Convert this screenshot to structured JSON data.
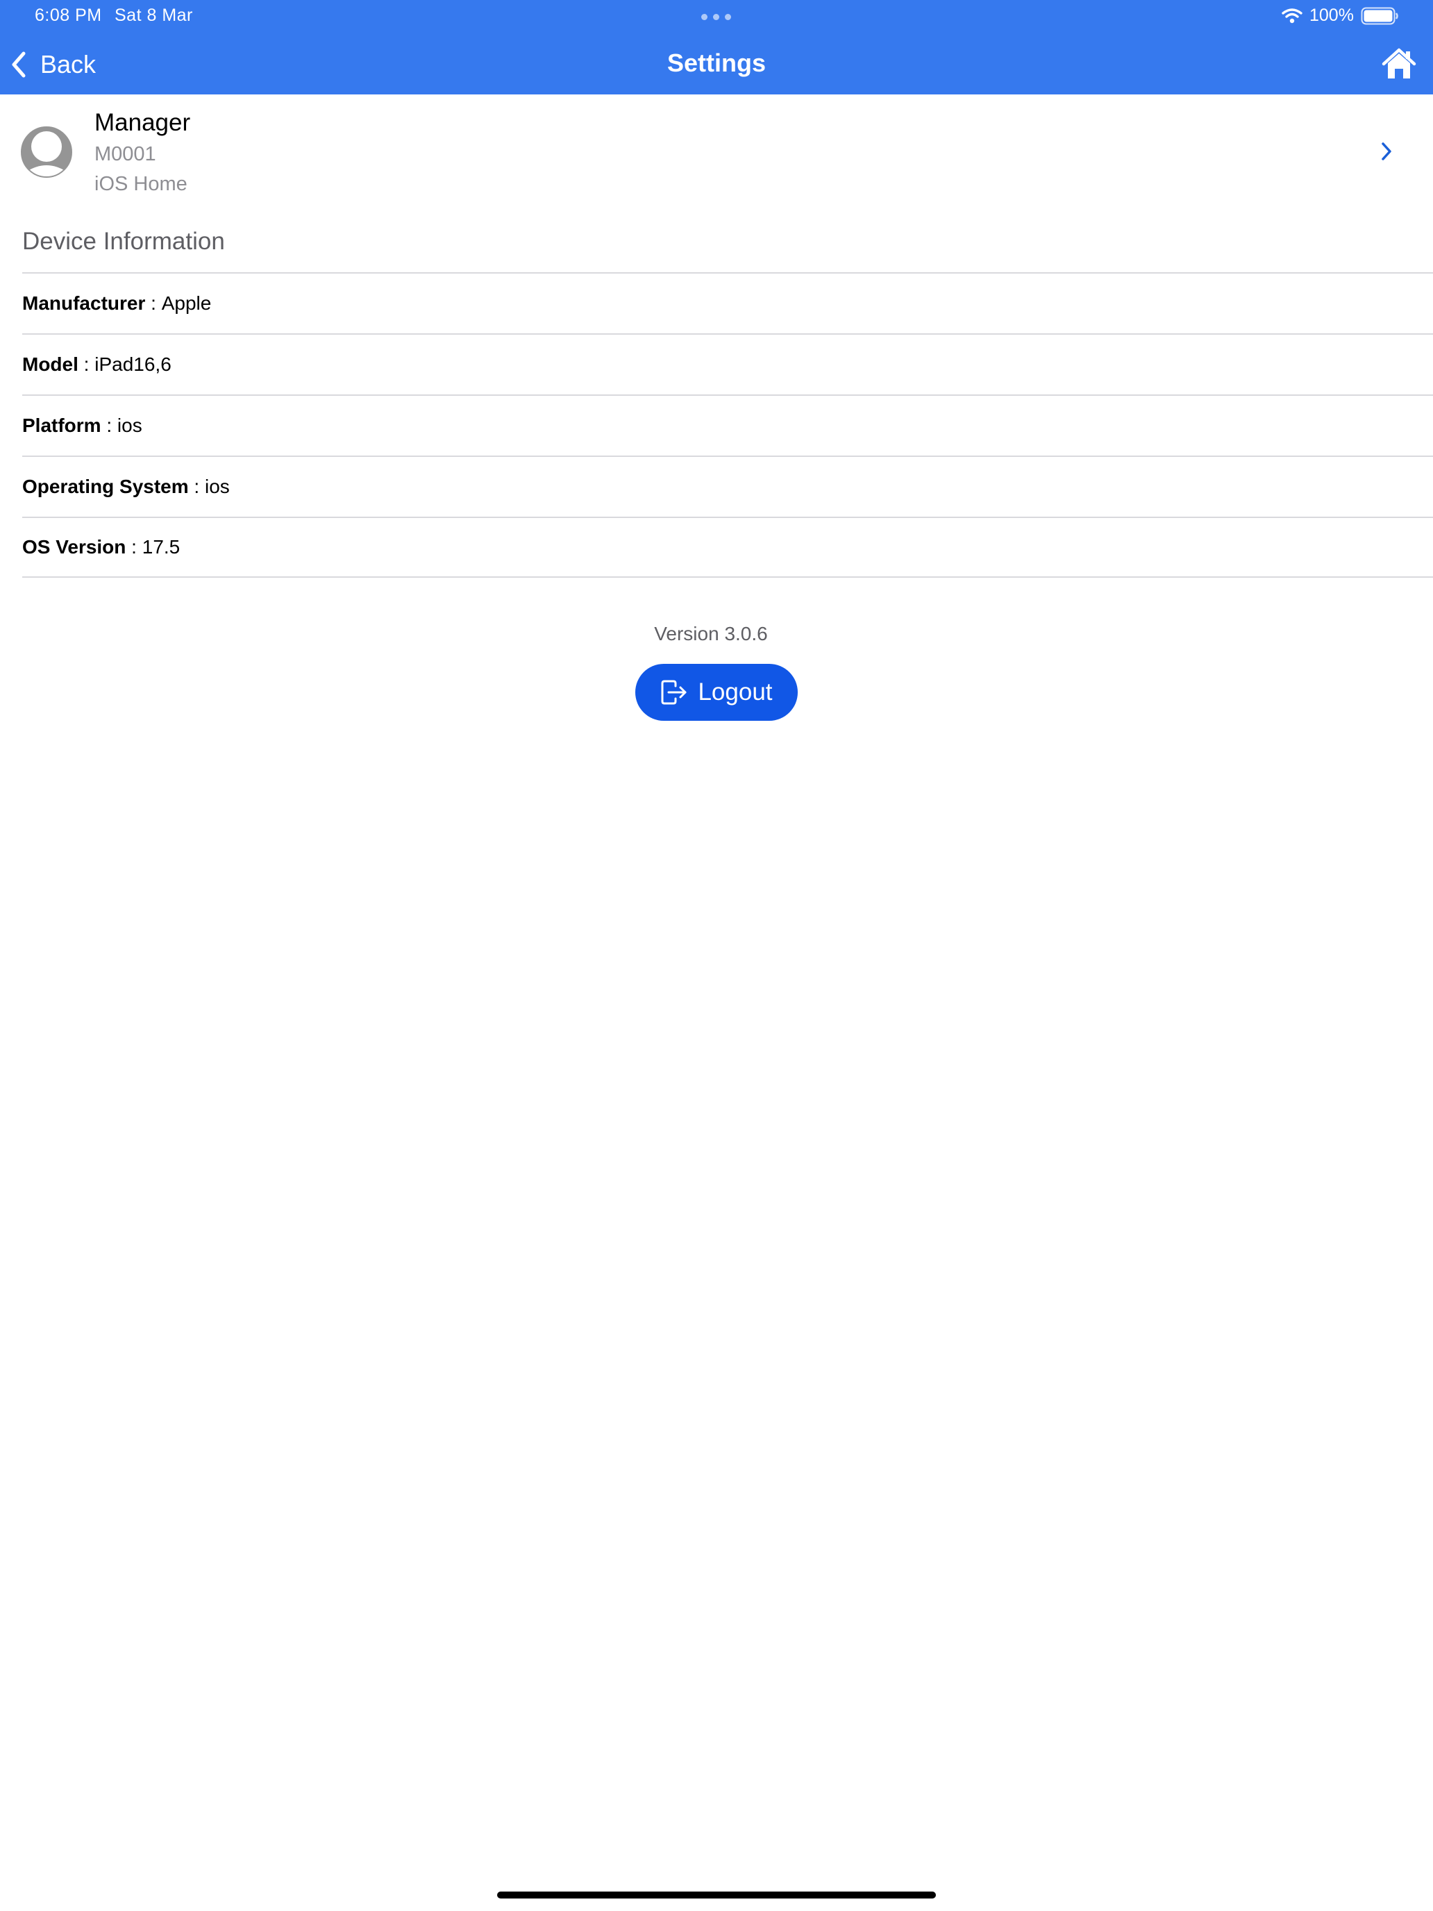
{
  "status_bar": {
    "time": "6:08 PM",
    "date": "Sat 8 Mar",
    "battery": "100%",
    "icons": [
      "wifi-icon",
      "battery-icon"
    ]
  },
  "nav": {
    "back_label": "Back",
    "title": "Settings",
    "right_icon": "home-icon"
  },
  "profile": {
    "name": "Manager",
    "id": "M0001",
    "subtitle": "iOS Home",
    "icon": "avatar-icon"
  },
  "device_info": {
    "title": "Device Information",
    "rows": [
      {
        "key": "Manufacturer",
        "sep": " : ",
        "value": "Apple"
      },
      {
        "key": "Model",
        "sep": " : ",
        "value": "iPad16,6"
      },
      {
        "key": "Platform",
        "sep": " : ",
        "value": "ios"
      },
      {
        "key": "Operating System",
        "sep": " : ",
        "value": "ios"
      },
      {
        "key": "OS Version",
        "sep": " : ",
        "value": "17.5"
      }
    ]
  },
  "footer": {
    "version": "Version 3.0.6",
    "logout_label": "Logout"
  },
  "colors": {
    "header": "#3679ee",
    "logout_button": "#1157e6",
    "chevron": "#1a5fd8",
    "muted_text": "#8e8e93"
  }
}
